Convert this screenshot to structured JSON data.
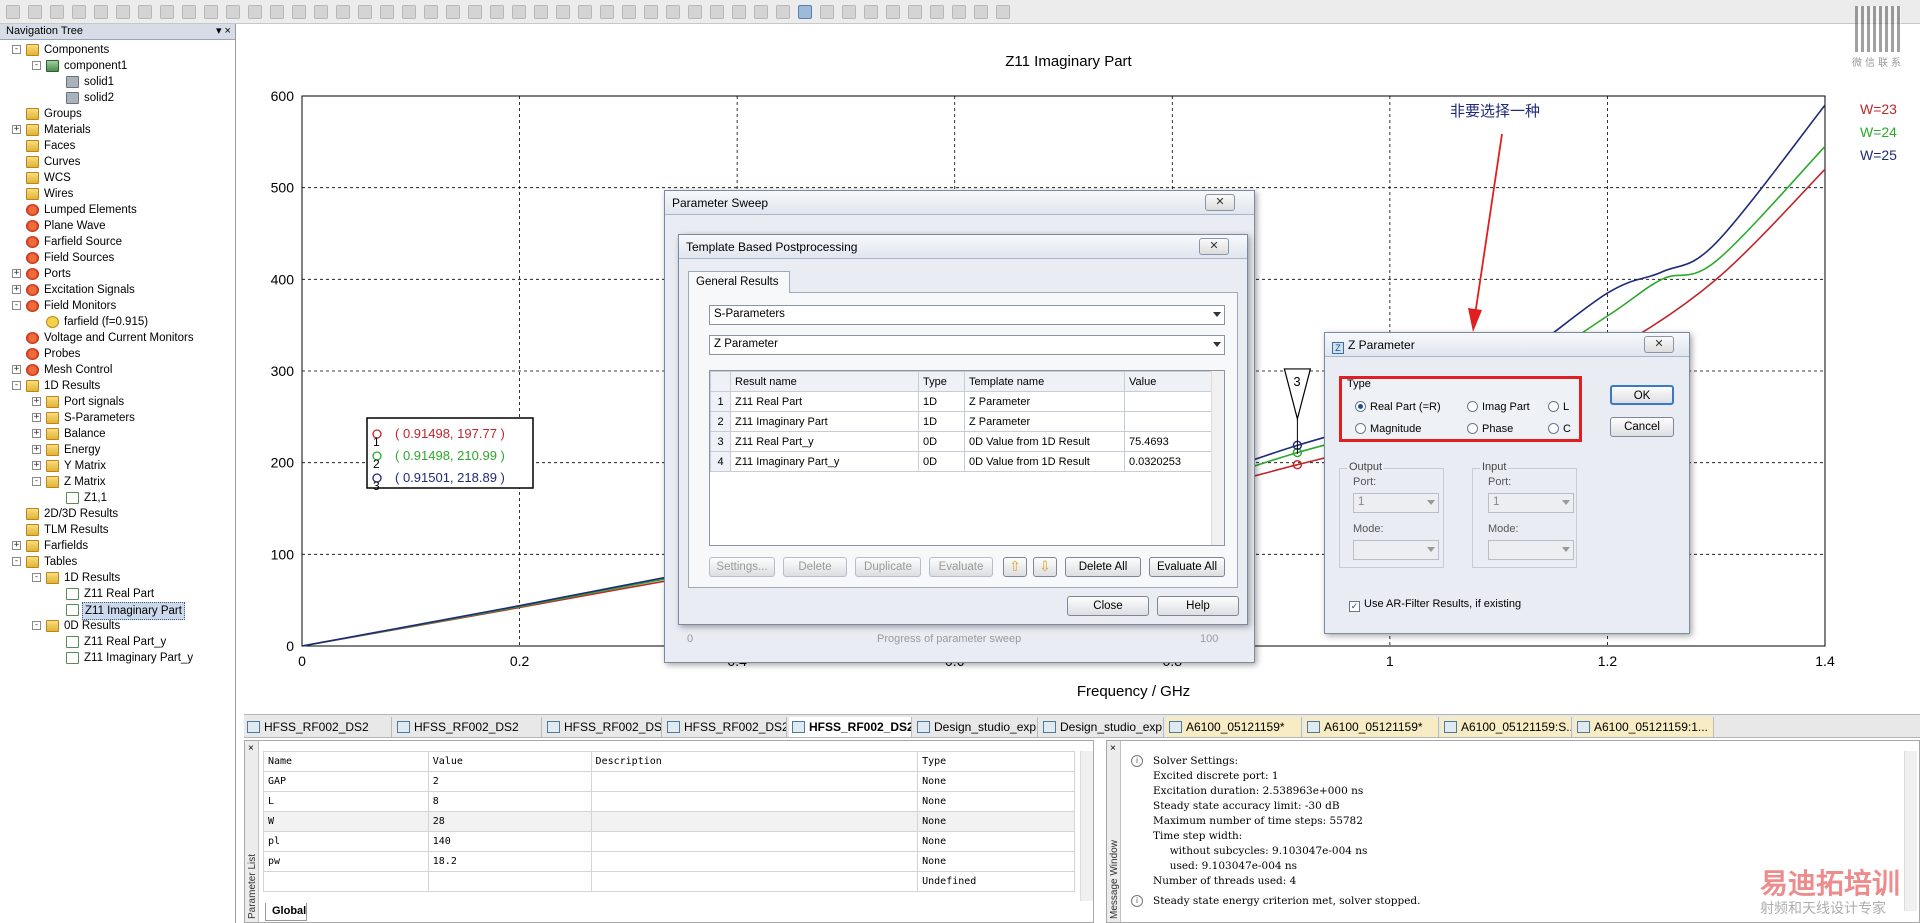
{
  "nav": {
    "title": "Navigation Tree",
    "items": [
      {
        "label": "Components",
        "x": 0,
        "y": 0,
        "icon": "folder",
        "exp": "-"
      },
      {
        "label": "component1",
        "x": 1,
        "y": 1,
        "icon": "comp",
        "exp": "-"
      },
      {
        "label": "solid1",
        "x": 2,
        "y": 2,
        "icon": "grey",
        "exp": ""
      },
      {
        "label": "solid2",
        "x": 2,
        "y": 3,
        "icon": "grey",
        "exp": ""
      },
      {
        "label": "Groups",
        "x": 0,
        "y": 4,
        "icon": "folder",
        "exp": ""
      },
      {
        "label": "Materials",
        "x": 0,
        "y": 5,
        "icon": "folder",
        "exp": "+"
      },
      {
        "label": "Faces",
        "x": 0,
        "y": 6,
        "icon": "folder",
        "exp": ""
      },
      {
        "label": "Curves",
        "x": 0,
        "y": 7,
        "icon": "folder",
        "exp": ""
      },
      {
        "label": "WCS",
        "x": 0,
        "y": 8,
        "icon": "folder",
        "exp": ""
      },
      {
        "label": "Wires",
        "x": 0,
        "y": 9,
        "icon": "folder",
        "exp": ""
      },
      {
        "label": "Lumped Elements",
        "x": 0,
        "y": 10,
        "icon": "red",
        "exp": ""
      },
      {
        "label": "Plane Wave",
        "x": 0,
        "y": 11,
        "icon": "red",
        "exp": ""
      },
      {
        "label": "Farfield Source",
        "x": 0,
        "y": 12,
        "icon": "red",
        "exp": ""
      },
      {
        "label": "Field Sources",
        "x": 0,
        "y": 13,
        "icon": "red",
        "exp": ""
      },
      {
        "label": "Ports",
        "x": 0,
        "y": 14,
        "icon": "red",
        "exp": "+"
      },
      {
        "label": "Excitation Signals",
        "x": 0,
        "y": 15,
        "icon": "red",
        "exp": "+"
      },
      {
        "label": "Field Monitors",
        "x": 0,
        "y": 16,
        "icon": "red",
        "exp": "-"
      },
      {
        "label": "farfield (f=0.915)",
        "x": 1,
        "y": 17,
        "icon": "ff",
        "exp": ""
      },
      {
        "label": "Voltage and Current Monitors",
        "x": 0,
        "y": 18,
        "icon": "red",
        "exp": ""
      },
      {
        "label": "Probes",
        "x": 0,
        "y": 19,
        "icon": "red",
        "exp": ""
      },
      {
        "label": "Mesh Control",
        "x": 0,
        "y": 20,
        "icon": "red",
        "exp": "+"
      },
      {
        "label": "1D Results",
        "x": 0,
        "y": 21,
        "icon": "folder",
        "exp": "-"
      },
      {
        "label": "Port signals",
        "x": 1,
        "y": 22,
        "icon": "folder",
        "exp": "+"
      },
      {
        "label": "S-Parameters",
        "x": 1,
        "y": 23,
        "icon": "folder",
        "exp": "+"
      },
      {
        "label": "Balance",
        "x": 1,
        "y": 24,
        "icon": "folder",
        "exp": "+"
      },
      {
        "label": "Energy",
        "x": 1,
        "y": 25,
        "icon": "folder",
        "exp": "+"
      },
      {
        "label": "Y Matrix",
        "x": 1,
        "y": 26,
        "icon": "folder",
        "exp": "+"
      },
      {
        "label": "Z Matrix",
        "x": 1,
        "y": 27,
        "icon": "folder",
        "exp": "-"
      },
      {
        "label": "Z1,1",
        "x": 2,
        "y": 28,
        "icon": "chart",
        "exp": ""
      },
      {
        "label": "2D/3D Results",
        "x": 0,
        "y": 29,
        "icon": "folder",
        "exp": ""
      },
      {
        "label": "TLM Results",
        "x": 0,
        "y": 30,
        "icon": "folder",
        "exp": ""
      },
      {
        "label": "Farfields",
        "x": 0,
        "y": 31,
        "icon": "folder",
        "exp": "+"
      },
      {
        "label": "Tables",
        "x": 0,
        "y": 32,
        "icon": "folder",
        "exp": "-"
      },
      {
        "label": "1D Results",
        "x": 1,
        "y": 33,
        "icon": "folder",
        "exp": "-"
      },
      {
        "label": "Z11 Real Part",
        "x": 2,
        "y": 34,
        "icon": "chart",
        "exp": ""
      },
      {
        "label": "Z11 Imaginary Part",
        "x": 2,
        "y": 35,
        "icon": "chart",
        "exp": "",
        "selected": true
      },
      {
        "label": "0D Results",
        "x": 1,
        "y": 36,
        "icon": "folder",
        "exp": "-"
      },
      {
        "label": "Z11 Real Part_y",
        "x": 2,
        "y": 37,
        "icon": "chart",
        "exp": ""
      },
      {
        "label": "Z11 Imaginary Part_y",
        "x": 2,
        "y": 38,
        "icon": "chart",
        "exp": ""
      }
    ]
  },
  "chart_data": {
    "type": "line",
    "title": "Z11 Imaginary Part",
    "xlabel": "Frequency / GHz",
    "ylabel": "",
    "xlim": [
      0,
      1.4
    ],
    "ylim": [
      0,
      600
    ],
    "xticks": [
      "0",
      "0.2",
      "0.4",
      "0.6",
      "0.8",
      "1",
      "1.2",
      "1.4"
    ],
    "yticks": [
      "0",
      "100",
      "200",
      "300",
      "400",
      "500",
      "600"
    ],
    "grid": true,
    "legend_position": "top-right",
    "series": [
      {
        "name": "W=23",
        "color": "#c0262b",
        "x": [
          0,
          0.2,
          0.4,
          0.6,
          0.8,
          0.91498,
          1.0,
          1.1,
          1.2,
          1.3,
          1.4
        ],
        "y": [
          0,
          42,
          85,
          125,
          165,
          197.77,
          225,
          270,
          320,
          400,
          520
        ]
      },
      {
        "name": "W=24",
        "color": "#2ca82c",
        "x": [
          0,
          0.2,
          0.4,
          0.6,
          0.8,
          0.91498,
          1.0,
          1.1,
          1.2,
          1.25,
          1.3,
          1.4
        ],
        "y": [
          0,
          43,
          88,
          130,
          172,
          210.99,
          240,
          285,
          360,
          400,
          420,
          545
        ]
      },
      {
        "name": "W=25",
        "color": "#1f2b7a",
        "x": [
          0,
          0.2,
          0.4,
          0.6,
          0.8,
          0.91501,
          1.0,
          1.1,
          1.2,
          1.25,
          1.3,
          1.4
        ],
        "y": [
          0,
          44,
          90,
          134,
          178,
          218.89,
          250,
          300,
          385,
          408,
          440,
          590
        ]
      }
    ],
    "markers": {
      "labels": [
        "1",
        "2",
        "3"
      ],
      "values": [
        "( 0.91498, 197.77 )",
        "( 0.91498, 210.99 )",
        "( 0.91501, 218.89 )"
      ]
    },
    "annotation": {
      "text": "非要选择一种",
      "color": "#1f2b7a",
      "arrow_color": "#e02020"
    }
  },
  "param_sweep": {
    "title": "Parameter Sweep",
    "progress_label": "Progress of parameter sweep",
    "progress_min": "0",
    "progress_max": "100"
  },
  "tbp": {
    "title": "Template Based Postprocessing",
    "tab": "General Results",
    "combo1": "S-Parameters",
    "combo2": "Z Parameter",
    "columns": [
      "Result name",
      "Type",
      "Template name",
      "Value"
    ],
    "rows": [
      {
        "n": "1",
        "name": "Z11 Real Part",
        "type": "1D",
        "template": "Z Parameter",
        "value": ""
      },
      {
        "n": "2",
        "name": "Z11 Imaginary Part",
        "type": "1D",
        "template": "Z Parameter",
        "value": ""
      },
      {
        "n": "3",
        "name": "Z11 Real Part_y",
        "type": "0D",
        "template": "0D Value from 1D Result",
        "value": "75.4693"
      },
      {
        "n": "4",
        "name": "Z11 Imaginary Part_y",
        "type": "0D",
        "template": "0D Value from 1D Result",
        "value": "0.0320253"
      }
    ],
    "buttons": {
      "settings": "Settings...",
      "delete": "Delete",
      "duplicate": "Duplicate",
      "evaluate": "Evaluate",
      "delete_all": "Delete All",
      "evaluate_all": "Evaluate All",
      "close": "Close",
      "help": "Help"
    }
  },
  "zparam": {
    "title": "Z Parameter",
    "type_label": "Type",
    "radios": {
      "real": "Real Part (=R)",
      "imag": "Imag Part",
      "l": "L",
      "mag": "Magnitude",
      "phase": "Phase",
      "c": "C"
    },
    "ok": "OK",
    "cancel": "Cancel",
    "output": "Output",
    "input": "Input",
    "port": "Port:",
    "mode": "Mode:",
    "port_val": "1",
    "ar_filter": "Use AR-Filter Results, if existing",
    "highlight_color": "#e02020"
  },
  "tabs": [
    {
      "label": "HFSS_RF002_DS2",
      "style": ""
    },
    {
      "label": "HFSS_RF002_DS2",
      "style": ""
    },
    {
      "label": "HFSS_RF002_DS2_p...",
      "style": ""
    },
    {
      "label": "HFSS_RF002_DS2_p...",
      "style": ""
    },
    {
      "label": "HFSS_RF002_DS2...",
      "style": "act"
    },
    {
      "label": "Design_studio_exp1*",
      "style": ""
    },
    {
      "label": "Design_studio_exp1:...",
      "style": ""
    },
    {
      "label": "A6100_05121159*",
      "style": "yel"
    },
    {
      "label": "A6100_05121159*",
      "style": "yel"
    },
    {
      "label": "A6100_05121159:S...",
      "style": "yel"
    },
    {
      "label": "A6100_05121159:1...",
      "style": "yel"
    }
  ],
  "params": {
    "side_label": "Parameter List",
    "columns": [
      "Name",
      "Value",
      "Description",
      "Type"
    ],
    "rows": [
      {
        "name": "GAP",
        "value": "2",
        "desc": "",
        "type": "None"
      },
      {
        "name": "L",
        "value": "8",
        "desc": "",
        "type": "None"
      },
      {
        "name": "W",
        "value": "28",
        "desc": "",
        "type": "None"
      },
      {
        "name": "pl",
        "value": "140",
        "desc": "",
        "type": "None"
      },
      {
        "name": "pw",
        "value": "18.2",
        "desc": "",
        "type": "None"
      },
      {
        "name": "",
        "value": "",
        "desc": "",
        "type": "Undefined"
      }
    ],
    "footer_tab": "Global"
  },
  "messages": {
    "side_label": "Message Window",
    "lines": [
      "Solver Settings:",
      "Excited discrete port: 1",
      "Excitation duration: 2.538963e+000 ns",
      "Steady state accuracy limit: -30 dB",
      "Maximum number of time steps: 55782",
      "Time step width:",
      "     without subcycles: 9.103047e-004 ns",
      "     used: 9.103047e-004 ns",
      "Number of threads used: 4"
    ],
    "last": "Steady state energy criterion met, solver stopped."
  },
  "watermark": {
    "brand": "易迪拓培训",
    "sub": "射频和天线设计专家",
    "qr_caption": "微信联系"
  }
}
